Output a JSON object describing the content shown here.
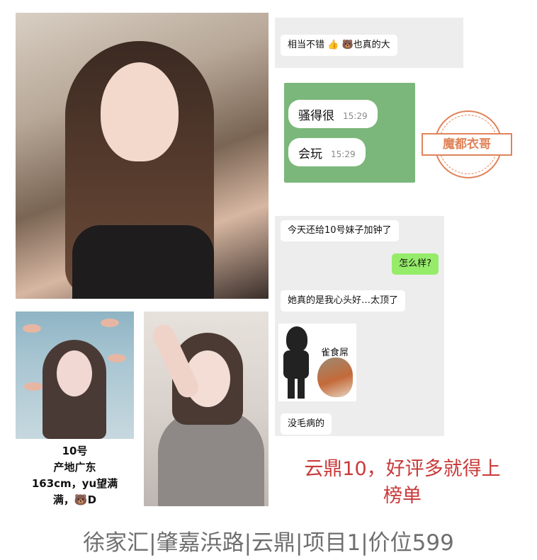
{
  "chat1": {
    "message": "相当不错 👍 🐻也真的大"
  },
  "green_card": {
    "messages": [
      {
        "text": "骚得很",
        "time": "15:29"
      },
      {
        "text": "会玩",
        "time": "15:29"
      }
    ]
  },
  "stamp": {
    "text": "魔都衣哥"
  },
  "chat2": {
    "messages": [
      {
        "from": "other",
        "text": "今天还给10号妹子加钟了"
      },
      {
        "from": "me",
        "text": "怎么样?"
      },
      {
        "from": "other",
        "text": "她真的是我心头好…太顶了"
      },
      {
        "from": "other",
        "text": "没毛病的"
      }
    ],
    "sticker_text": "雀食屌"
  },
  "caption": {
    "lines": [
      "10号",
      "产地广东",
      "163cm，yu望满",
      "满，🐻D"
    ]
  },
  "headline": {
    "lines": [
      "云鼎10，好评多就得上",
      "榜单"
    ]
  },
  "footer": {
    "text": "徐家汇|肇嘉浜路|云鼎|项目1|价位599"
  },
  "colors": {
    "headline": "#c93a3a",
    "stamp": "#e0845a",
    "chat_green": "#95ec69",
    "card_green": "#7bb77a"
  }
}
